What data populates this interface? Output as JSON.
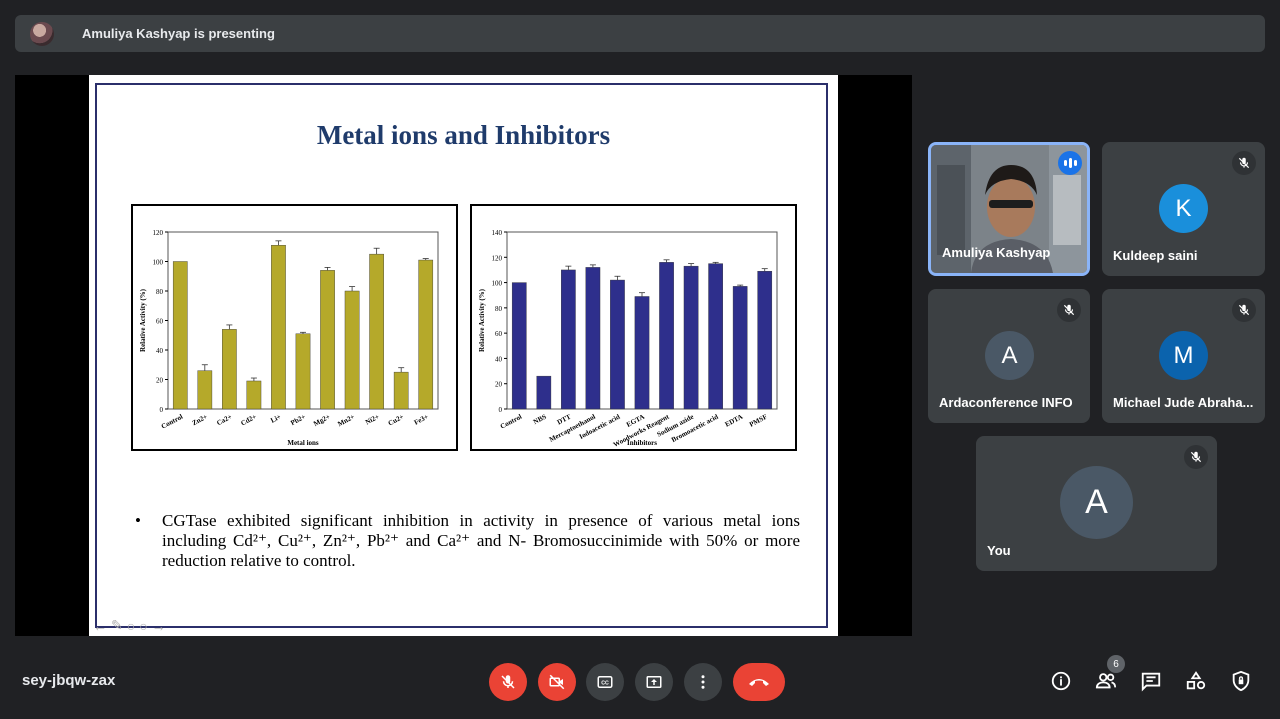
{
  "presenter_bar": {
    "text": "Amuliya Kashyap is presenting"
  },
  "slide": {
    "title": "Metal ions and Inhibitors",
    "bullet": "CGTase exhibited significant inhibition in activity in presence of various metal ions including Cd²⁺, Cu²⁺, Zn²⁺, Pb²⁺ and Ca²⁺ and N- Bromosuccinimide with 50% or more reduction relative to control."
  },
  "chart_data": [
    {
      "type": "bar",
      "title": "",
      "xlabel": "Metal ions",
      "ylabel": "Relative Activity (%)",
      "ylim": [
        0,
        120
      ],
      "yticks": [
        0,
        20,
        40,
        60,
        80,
        100,
        120
      ],
      "color": "#b5a92a",
      "categories": [
        "Control",
        "Zn2+",
        "Ca2+",
        "Cd2+",
        "Li+",
        "Pb2+",
        "Mg2+",
        "Mn2+",
        "Ni2+",
        "Cu2+",
        "Fe3+"
      ],
      "values": [
        100,
        26,
        54,
        19,
        111,
        51,
        94,
        80,
        105,
        25,
        101
      ],
      "errors": [
        0,
        4,
        3,
        2,
        3,
        1,
        2,
        3,
        4,
        3,
        1
      ],
      "grid": false
    },
    {
      "type": "bar",
      "title": "",
      "xlabel": "Inhibitors",
      "ylabel": "Relative Activity (%)",
      "ylim": [
        0,
        140
      ],
      "yticks": [
        0,
        20,
        40,
        60,
        80,
        100,
        120,
        140
      ],
      "color": "#2e2f8c",
      "categories": [
        "Control",
        "NBS",
        "DTT",
        "Mercaptoethanol",
        "Iodoacetic acid",
        "EGTA",
        "Woodworks Reagent",
        "Sodium azide",
        "Bromoacetic acid",
        "EDTA",
        "PMSF"
      ],
      "values": [
        100,
        26,
        110,
        112,
        102,
        89,
        116,
        113,
        115,
        97,
        109
      ],
      "errors": [
        0,
        0,
        3,
        2,
        3,
        3,
        2,
        2,
        1,
        1,
        2
      ],
      "grid": false
    }
  ],
  "participants": [
    {
      "name": "Amuliya Kashyap",
      "type": "video",
      "speaking": true
    },
    {
      "name": "Kuldeep saini",
      "initial": "K",
      "color": "#1a8fdb",
      "muted": true
    },
    {
      "name": "Ardaconference INFO",
      "initial": "A",
      "color": "#4a5866",
      "muted": true
    },
    {
      "name": "Michael Jude Abraha...",
      "initial": "M",
      "color": "#0b63ad",
      "muted": true
    },
    {
      "name": "You",
      "initial": "A",
      "color": "#4a5866",
      "muted": true
    }
  ],
  "bottom": {
    "meeting_code": "sey-jbqw-zax",
    "people_count": "6"
  },
  "icons": {
    "mic": "mic-off-icon",
    "cam": "camera-off-icon",
    "cc": "captions-icon",
    "present": "present-screen-icon",
    "more": "more-options-icon",
    "hangup": "hang-up-icon",
    "info": "info-icon",
    "people": "people-icon",
    "chat": "chat-icon",
    "activities": "activities-icon",
    "safety": "host-controls-icon"
  }
}
